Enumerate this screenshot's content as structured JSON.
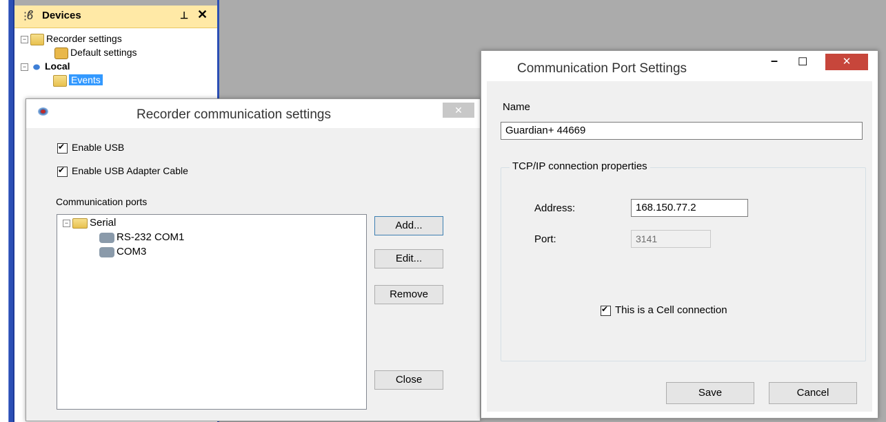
{
  "devices_panel": {
    "title": "Devices",
    "pin_glyph": "⊥",
    "close_glyph": "✕",
    "tree": {
      "recorder_settings": "Recorder settings",
      "default_settings": "Default settings",
      "local": "Local",
      "events": "Events"
    }
  },
  "recorder_dialog": {
    "title": "Recorder communication settings",
    "close_glyph": "✕",
    "enable_usb": "Enable USB",
    "enable_usb_adapter": "Enable USB Adapter Cable",
    "ports_label": "Communication ports",
    "ports_tree": {
      "serial": "Serial",
      "items": [
        "RS-232 COM1",
        "COM3"
      ]
    },
    "buttons": {
      "add": "Add...",
      "edit": "Edit...",
      "remove": "Remove",
      "close": "Close"
    }
  },
  "port_dialog": {
    "title": "Communication Port Settings",
    "minimize_glyph": "–",
    "maximize_glyph": "☐",
    "close_glyph": "✕",
    "name_label": "Name",
    "name_value": "Guardian+ 44669",
    "group_label": "TCP/IP connection properties",
    "address_label": "Address:",
    "address_value": "168.150.77.2",
    "port_label": "Port:",
    "port_value": "3141",
    "cell_label": "This is a Cell connection",
    "save": "Save",
    "cancel": "Cancel"
  },
  "colors": {
    "background": "#ababab",
    "panel_header": "#ffe9a6",
    "selection": "#3399ff",
    "close_red": "#c7463b"
  }
}
